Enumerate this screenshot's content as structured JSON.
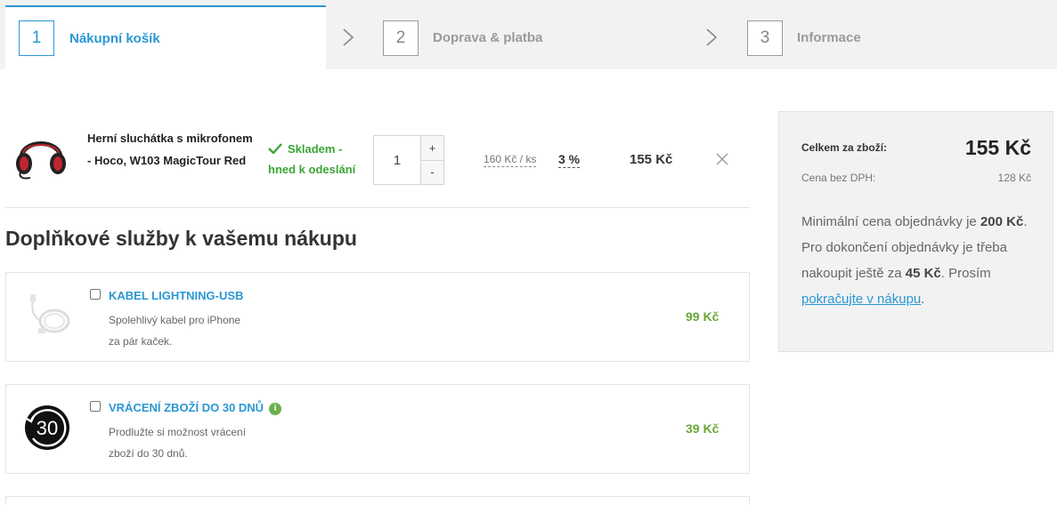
{
  "steps": [
    {
      "num": "1",
      "label": "Nákupní košík",
      "active": true
    },
    {
      "num": "2",
      "label": "Doprava & platba",
      "active": false
    },
    {
      "num": "3",
      "label": "Informace",
      "active": false
    }
  ],
  "cart": {
    "item": {
      "name": "Herní sluchátka s mikrofonem - Hoco, W103 MagicTour Red",
      "image_icon": "headphones-icon",
      "stock_line1": "Skladem -",
      "stock_line2": "hned k odeslání",
      "quantity": "1",
      "plus": "+",
      "minus": "-",
      "unit_price": "160 Kč / ks",
      "discount": "3 %",
      "price": "155 Kč"
    }
  },
  "services": {
    "title": "Doplňkové služby k vašemu nákupu",
    "items": [
      {
        "title": "KABEL LIGHTNING-USB",
        "desc_line1": "Spolehlivý kabel pro iPhone",
        "desc_line2": "za pár kaček.",
        "price": "99 Kč",
        "icon": "cable-icon",
        "info": false
      },
      {
        "title": "VRÁCENÍ ZBOŽÍ DO 30 DNŮ",
        "desc_line1": "Prodlužte si možnost vrácení",
        "desc_line2": "zboží do 30 dnů.",
        "price": "39 Kč",
        "icon": "return-30-days-icon",
        "info": true,
        "info_glyph": "i",
        "badge_text": "30"
      }
    ]
  },
  "summary": {
    "total_label": "Celkem za zboží:",
    "total_value": "155 Kč",
    "novat_label": "Cena bez DPH:",
    "novat_value": "128 Kč",
    "msg_part1": "Minimální cena objednávky je ",
    "msg_min": "200 Kč",
    "msg_part2": ". Pro dokončení objednávky je třeba nakoupit ještě za ",
    "msg_remaining": "45 Kč",
    "msg_part3": ". Prosím ",
    "msg_link": "pokračujte v nákupu",
    "msg_part4": "."
  },
  "colors": {
    "accent": "#2a97d4",
    "stock_green": "#3aa635",
    "price_green": "#6aa634",
    "summary_bg": "#f2f2f2"
  }
}
